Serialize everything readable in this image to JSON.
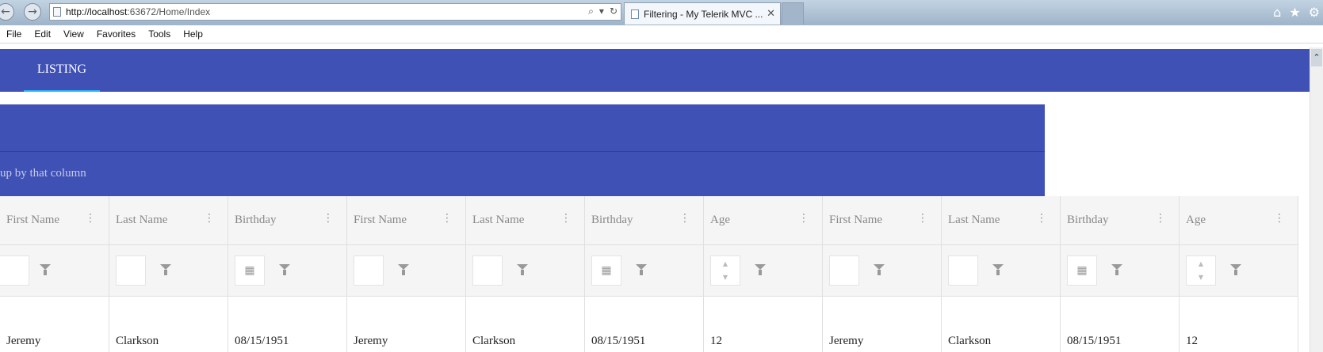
{
  "browser": {
    "url_host": "http://localhost",
    "url_rest": ":63672/Home/Index",
    "tab_title": "Filtering - My Telerik MVC ...",
    "menu": [
      "File",
      "Edit",
      "View",
      "Favorites",
      "Tools",
      "Help"
    ]
  },
  "page": {
    "nav_item": "LISTING",
    "group_hint": "up by that column"
  },
  "grid": {
    "columns": [
      "First Name",
      "Last Name",
      "Birthday",
      "First Name",
      "Last Name",
      "Birthday",
      "Age",
      "First Name",
      "Last Name",
      "Birthday",
      "Age"
    ],
    "filter_types": [
      "text",
      "text",
      "date",
      "text",
      "text",
      "date",
      "number",
      "text",
      "text",
      "date",
      "number"
    ],
    "row": [
      "Jeremy",
      "Clarkson",
      "08/15/1951",
      "Jeremy",
      "Clarkson",
      "08/15/1951",
      "12",
      "Jeremy",
      "Clarkson",
      "08/15/1951",
      "12"
    ]
  },
  "colors": {
    "primary": "#3f51b5",
    "accent": "#29b6f6"
  }
}
